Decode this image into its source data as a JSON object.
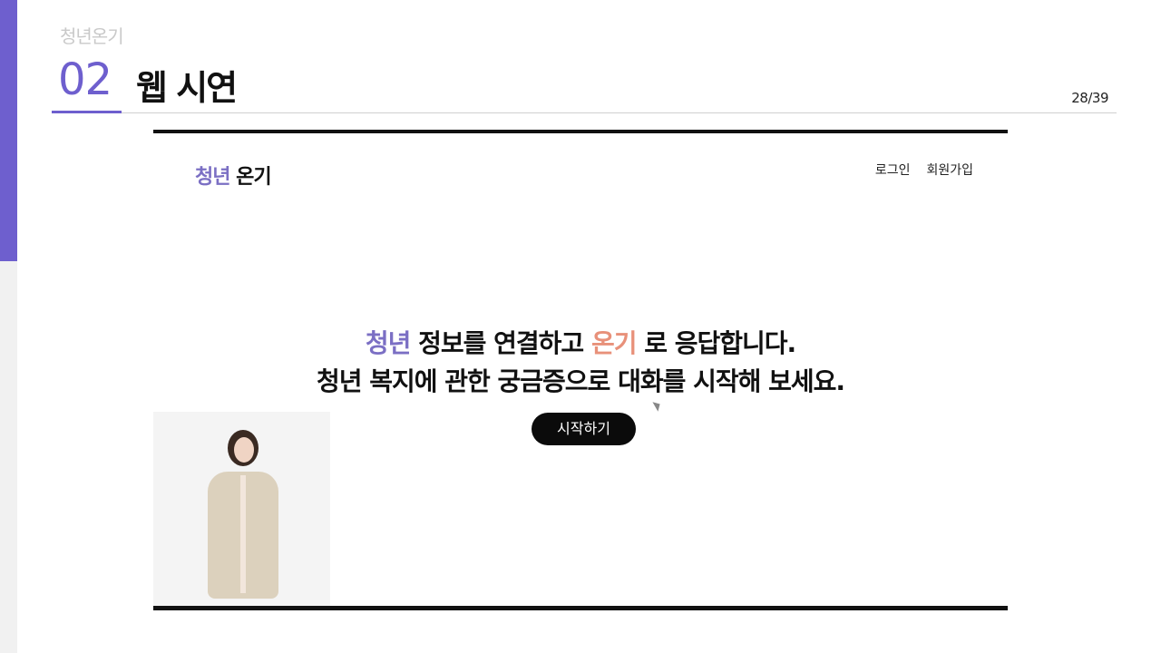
{
  "slide": {
    "brand": "청년온기",
    "section_number": "02",
    "section_title": "웹 시연",
    "page_number": "28/39"
  },
  "site": {
    "logo_part1": "청년",
    "logo_part2": " 온기",
    "nav": [
      "로그인",
      "회원가입"
    ],
    "hero_line1_a": "청년",
    "hero_line1_b": " 정보를 연결하고 ",
    "hero_line1_c": "온기",
    "hero_line1_d": " 로 응답합니다.",
    "hero_line2": "청년 복지에 관한 궁금증으로 대화를 시작해 보세요.",
    "start_button": "시작하기"
  },
  "colors": {
    "accent": "#6e5fce",
    "logo_purple": "#7b6fc4",
    "warm": "#e8917a"
  }
}
